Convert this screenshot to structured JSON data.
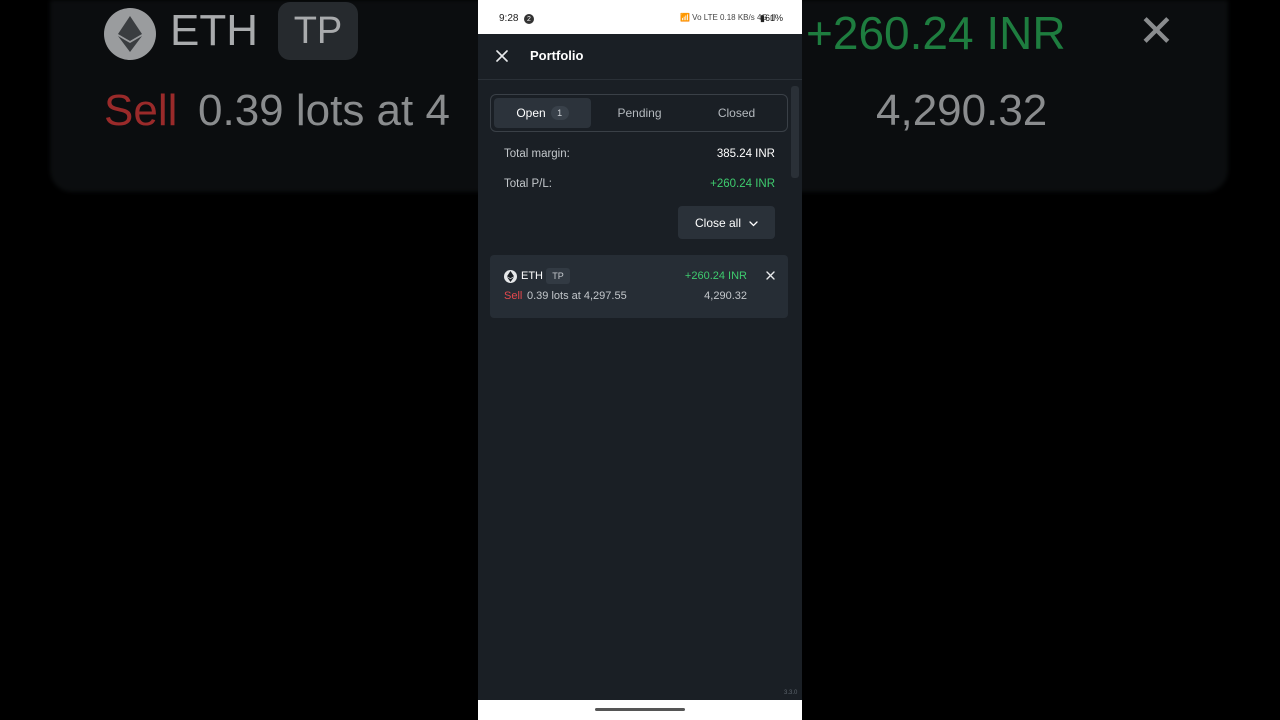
{
  "background": {
    "symbol": "ETH",
    "tp": "TP",
    "pl": "+260.24 INR",
    "sell": "Sell",
    "lots": "0.39 lots at 4",
    "price": "4,290.32",
    "close": "✕"
  },
  "status_bar": {
    "time": "9:28",
    "notification": "2",
    "icons": "📶 Vo LTE 0.18 KB/s 4G ıll",
    "battery": "▮61%"
  },
  "header": {
    "title": "Portfolio",
    "close_icon": "close-icon"
  },
  "tabs": [
    {
      "label": "Open",
      "count": "1",
      "active": true
    },
    {
      "label": "Pending",
      "active": false
    },
    {
      "label": "Closed",
      "active": false
    }
  ],
  "summary": {
    "margin_label": "Total margin:",
    "margin_value": "385.24 INR",
    "pl_label": "Total P/L:",
    "pl_value": "+260.24 INR"
  },
  "close_all": {
    "label": "Close all",
    "icon": "chevron-down-icon"
  },
  "position": {
    "symbol": "ETH",
    "badge": "TP",
    "pl": "+260.24 INR",
    "side": "Sell",
    "details": "0.39 lots at 4,297.55",
    "current_price": "4,290.32"
  },
  "version": "3.3.0",
  "colors": {
    "profit": "#3ecb6e",
    "sell": "#e5484d",
    "panel": "#1a1f25",
    "card": "#262d35"
  }
}
